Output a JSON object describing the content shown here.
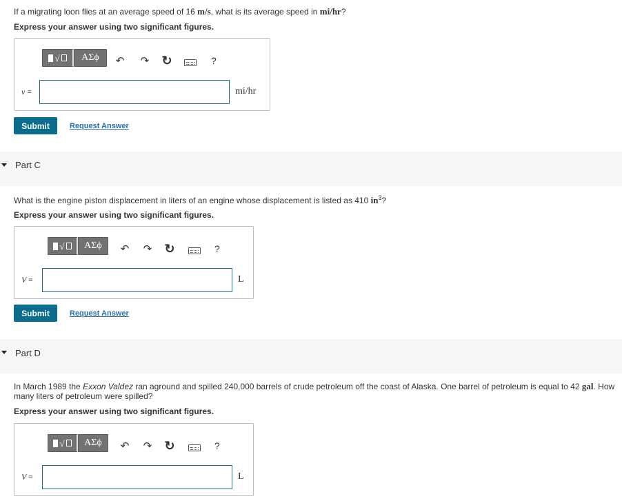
{
  "partB": {
    "question": {
      "pre": "If a migrating loon flies at an average speed of 16 ",
      "unit1": "m/s",
      "mid": ", what is its average speed in ",
      "unit2": "mi/hr",
      "post": "?"
    },
    "instruction": "Express your answer using two significant figures.",
    "var_label": "v",
    "eq": "=",
    "input_value": "",
    "unit": "mi/hr",
    "submit_label": "Submit",
    "request_label": "Request Answer"
  },
  "partC": {
    "title": "Part C",
    "question": {
      "pre": "What is the engine piston displacement in liters of an engine whose displacement is listed as 410 ",
      "unit": "in",
      "sup": "3",
      "post": "?"
    },
    "instruction": "Express your answer using two significant figures.",
    "var_label": "V",
    "eq": "=",
    "input_value": "",
    "unit": "L",
    "submit_label": "Submit",
    "request_label": "Request Answer"
  },
  "partD": {
    "title": "Part D",
    "question": {
      "line1_pre": "In March 1989 the ",
      "ship": "Exxon Valdez",
      "line1_mid": " ran aground and spilled 240,000 barrels of crude petroleum off the coast of Alaska. One barrel of petroleum is equal to 42 ",
      "unit": "gal",
      "line1_post": ". How",
      "line2": "many liters of petroleum were spilled?"
    },
    "instruction": "Express your answer using two significant figures.",
    "var_label": "V",
    "eq": "=",
    "input_value": "",
    "unit": "L"
  },
  "toolbar": {
    "greek_label": "ΑΣϕ",
    "undo_glyph": "↶",
    "redo_glyph": "↷",
    "reset_glyph": "↻",
    "help_label": "?",
    "icons": [
      "templates-icon",
      "greek-symbols-icon",
      "undo-icon",
      "redo-icon",
      "reset-icon",
      "keyboard-icon",
      "help-icon"
    ]
  },
  "colors": {
    "submit": "#0b6d8e",
    "link": "#2a6ea6",
    "input_border": "#1b6e8c",
    "band": "#f6f6f6"
  }
}
